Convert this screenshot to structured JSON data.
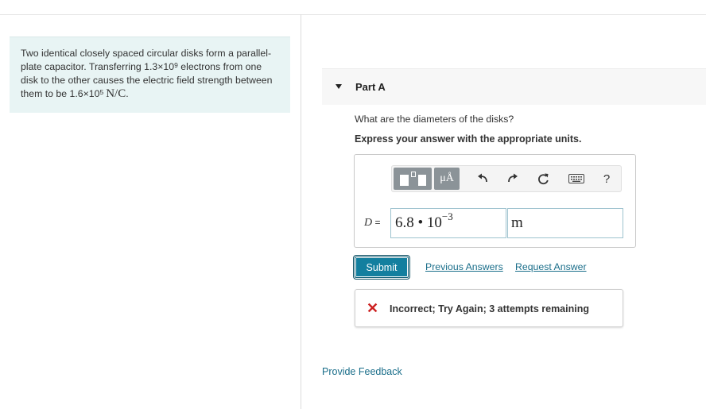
{
  "problem": {
    "text_1": "Two identical closely spaced circular disks form a parallel-plate capacitor. Transferring 1.3×10",
    "exp_1": "9",
    "text_2": " electrons from one disk to the other causes the electric field strength between them to be 1.6×10",
    "exp_2": "5",
    "unit": "N/C",
    "end": "."
  },
  "part": {
    "title": "Part A"
  },
  "question": "What are the diameters of the disks?",
  "instruction": "Express your answer with the appropriate units.",
  "toolbar": {
    "units_label": "μÅ",
    "help_label": "?",
    "icons": [
      "templates-icon",
      "units-icon",
      "undo-icon",
      "redo-icon",
      "reset-icon",
      "keyboard-icon",
      "help-icon"
    ]
  },
  "answer": {
    "variable": "D",
    "equals": " = ",
    "value_mantissa": "6.8 • 10",
    "value_exponent": "−3",
    "unit": "m"
  },
  "buttons": {
    "submit": "Submit",
    "previous_answers": "Previous Answers",
    "request_answer": "Request Answer"
  },
  "feedback": {
    "status": "Incorrect; Try Again; 3 attempts remaining"
  },
  "footer": {
    "provide_feedback": "Provide Feedback"
  },
  "colors": {
    "accent": "#137f9f",
    "link": "#1a6e8a",
    "error": "#cc1f1f",
    "problem_bg": "#e8f4f4"
  }
}
